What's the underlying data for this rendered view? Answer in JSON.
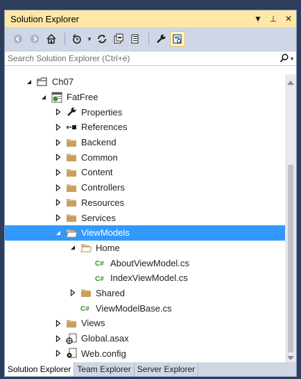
{
  "window": {
    "title": "Solution Explorer",
    "controls": {
      "dropdown": "▼",
      "pin": "⊥",
      "close": "✕"
    }
  },
  "toolbar": {
    "buttons": [
      "back-icon",
      "forward-icon",
      "home-icon",
      "history-icon",
      "sync-icon",
      "collapse-all-icon",
      "show-all-files-icon",
      "properties-icon",
      "preview-icon"
    ]
  },
  "search": {
    "placeholder": "Search Solution Explorer (Ctrl+è)"
  },
  "tree": {
    "items": [
      {
        "label": "Ch07",
        "depth": 1,
        "expanded": true,
        "icon": "solution-folder-icon"
      },
      {
        "label": "FatFree",
        "depth": 2,
        "expanded": true,
        "icon": "web-project-icon"
      },
      {
        "label": "Properties",
        "depth": 3,
        "expanded": false,
        "icon": "wrench-icon"
      },
      {
        "label": "References",
        "depth": 3,
        "expanded": false,
        "icon": "references-icon"
      },
      {
        "label": "Backend",
        "depth": 3,
        "expanded": false,
        "icon": "folder-icon"
      },
      {
        "label": "Common",
        "depth": 3,
        "expanded": false,
        "icon": "folder-icon"
      },
      {
        "label": "Content",
        "depth": 3,
        "expanded": false,
        "icon": "folder-icon"
      },
      {
        "label": "Controllers",
        "depth": 3,
        "expanded": false,
        "icon": "folder-icon"
      },
      {
        "label": "Resources",
        "depth": 3,
        "expanded": false,
        "icon": "folder-icon"
      },
      {
        "label": "Services",
        "depth": 3,
        "expanded": false,
        "icon": "folder-icon"
      },
      {
        "label": "ViewModels",
        "depth": 3,
        "expanded": true,
        "selected": true,
        "icon": "open-folder-icon"
      },
      {
        "label": "Home",
        "depth": 4,
        "expanded": true,
        "icon": "open-folder-icon"
      },
      {
        "label": "AboutViewModel.cs",
        "depth": 5,
        "icon": "csharp-file-icon"
      },
      {
        "label": "IndexViewModel.cs",
        "depth": 5,
        "icon": "csharp-file-icon"
      },
      {
        "label": "Shared",
        "depth": 4,
        "expanded": false,
        "icon": "folder-icon"
      },
      {
        "label": "ViewModelBase.cs",
        "depth": 4,
        "icon": "csharp-file-icon"
      },
      {
        "label": "Views",
        "depth": 3,
        "expanded": false,
        "icon": "folder-icon"
      },
      {
        "label": "Global.asax",
        "depth": 3,
        "expanded": false,
        "icon": "global-asax-icon"
      },
      {
        "label": "Web.config",
        "depth": 3,
        "expanded": false,
        "icon": "config-file-icon"
      }
    ]
  },
  "tabs": [
    {
      "label": "Solution Explorer",
      "active": true
    },
    {
      "label": "Team Explorer",
      "active": false
    },
    {
      "label": "Server Explorer",
      "active": false
    }
  ],
  "colors": {
    "title_bar": "#ffe8a6",
    "toolbar": "#cfd6e5",
    "selection": "#3399ff",
    "folder": "#dcb67a",
    "csharp": "#388a34",
    "frame": "#2c3e5c"
  }
}
